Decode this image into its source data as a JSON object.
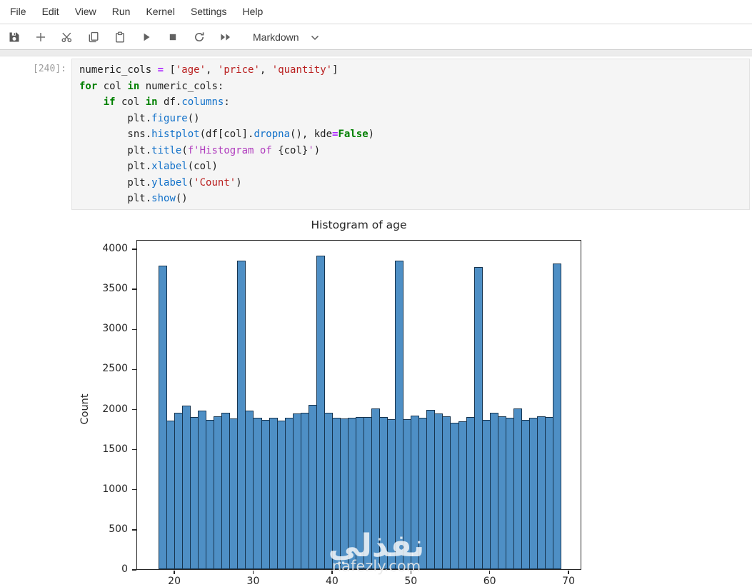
{
  "menu": {
    "items": [
      "File",
      "Edit",
      "View",
      "Run",
      "Kernel",
      "Settings",
      "Help"
    ]
  },
  "toolbar": {
    "buttons": [
      "save",
      "insert-cell",
      "cut",
      "copy",
      "paste",
      "run",
      "interrupt",
      "restart",
      "run-all"
    ],
    "cell_type_selector": {
      "value": "Markdown"
    }
  },
  "cell": {
    "prompt": "[240]:",
    "lines": [
      [
        [
          "v",
          "numeric_cols "
        ],
        [
          "op",
          "="
        ],
        [
          "v",
          " ["
        ],
        [
          "str",
          "'age'"
        ],
        [
          "v",
          ", "
        ],
        [
          "str",
          "'price'"
        ],
        [
          "v",
          ", "
        ],
        [
          "str",
          "'quantity'"
        ],
        [
          "v",
          "]"
        ]
      ],
      [
        [
          "kw",
          "for"
        ],
        [
          "v",
          " col "
        ],
        [
          "kw",
          "in"
        ],
        [
          "v",
          " numeric_cols:"
        ]
      ],
      [
        [
          "v",
          "    "
        ],
        [
          "kw",
          "if"
        ],
        [
          "v",
          " col "
        ],
        [
          "kw",
          "in"
        ],
        [
          "v",
          " df."
        ],
        [
          "fn",
          "columns"
        ],
        [
          "v",
          ":"
        ]
      ],
      [
        [
          "v",
          "        plt."
        ],
        [
          "fn",
          "figure"
        ],
        [
          "v",
          "()"
        ]
      ],
      [
        [
          "v",
          "        sns."
        ],
        [
          "fn",
          "histplot"
        ],
        [
          "v",
          "(df[col]."
        ],
        [
          "fn",
          "dropna"
        ],
        [
          "v",
          "(), kde"
        ],
        [
          "op",
          "="
        ],
        [
          "kw",
          "False"
        ],
        [
          "v",
          ")"
        ]
      ],
      [
        [
          "v",
          "        plt."
        ],
        [
          "fn",
          "title"
        ],
        [
          "v",
          "("
        ],
        [
          "fstr",
          "f'Histogram of "
        ],
        [
          "v",
          "{col}"
        ],
        [
          "fstr",
          "'"
        ],
        [
          "v",
          ")"
        ]
      ],
      [
        [
          "v",
          "        plt."
        ],
        [
          "fn",
          "xlabel"
        ],
        [
          "v",
          "(col)"
        ]
      ],
      [
        [
          "v",
          "        plt."
        ],
        [
          "fn",
          "ylabel"
        ],
        [
          "v",
          "("
        ],
        [
          "str",
          "'Count'"
        ],
        [
          "v",
          ")"
        ]
      ],
      [
        [
          "v",
          "        plt."
        ],
        [
          "fn",
          "show"
        ],
        [
          "v",
          "()"
        ]
      ]
    ]
  },
  "chart_data": {
    "type": "bar",
    "title": "Histogram of age",
    "ylabel": "Count",
    "xlabel": "",
    "bin_start": 18,
    "bin_width": 1,
    "values": [
      3790,
      1855,
      1950,
      2040,
      1895,
      1975,
      1865,
      1905,
      1950,
      1880,
      3850,
      1975,
      1890,
      1865,
      1890,
      1855,
      1885,
      1945,
      1955,
      2050,
      3910,
      1950,
      1890,
      1880,
      1885,
      1895,
      1900,
      2000,
      1900,
      1870,
      3850,
      1870,
      1915,
      1890,
      1985,
      1945,
      1905,
      1825,
      1845,
      1900,
      3770,
      1865,
      1955,
      1910,
      1885,
      2000,
      1865,
      1885,
      1910,
      1895,
      3810
    ],
    "xticks": [
      20,
      30,
      40,
      50,
      60,
      70
    ],
    "yticks": [
      0,
      500,
      1000,
      1500,
      2000,
      2500,
      3000,
      3500,
      4000
    ],
    "ylim": [
      0,
      4150
    ],
    "xlim": [
      15.3,
      71.5
    ],
    "grid": false,
    "legend": false,
    "bar_color": "#4e8fc5",
    "bar_edge_color": "#16344f",
    "watermark": {
      "text": "نفذلي",
      "url_text": "nafezly.com"
    }
  }
}
